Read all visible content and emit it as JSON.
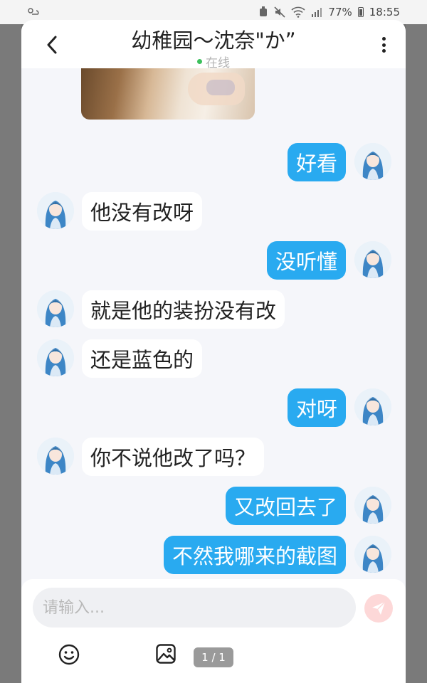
{
  "status_bar": {
    "battery": "77%",
    "time": "18:55"
  },
  "header": {
    "title": "幼稚园～沈奈\"か”",
    "status": "在线",
    "back_icon": "chevron-left-icon",
    "more_icon": "more-vertical-icon"
  },
  "messages": [
    {
      "side": "out",
      "text": "好看"
    },
    {
      "side": "in",
      "text": "他没有改呀"
    },
    {
      "side": "out",
      "text": "没听懂"
    },
    {
      "side": "in",
      "text": "就是他的装扮没有改"
    },
    {
      "side": "in",
      "text": "还是蓝色的"
    },
    {
      "side": "out",
      "text": "对呀"
    },
    {
      "side": "in",
      "text": "你不说他改了吗？"
    },
    {
      "side": "out",
      "text": "又改回去了"
    },
    {
      "side": "out",
      "text": "不然我哪来的截图"
    }
  ],
  "composer": {
    "placeholder": "请输入...",
    "page_indicator": "1 / 1",
    "send_icon": "send-icon",
    "emoji_icon": "emoji-icon",
    "image_icon": "image-icon"
  },
  "colors": {
    "outgoing_bubble": "#29aaf0",
    "incoming_bubble": "#ffffff",
    "online_dot": "#3cc05c",
    "send_button": "#fdd8d8"
  }
}
